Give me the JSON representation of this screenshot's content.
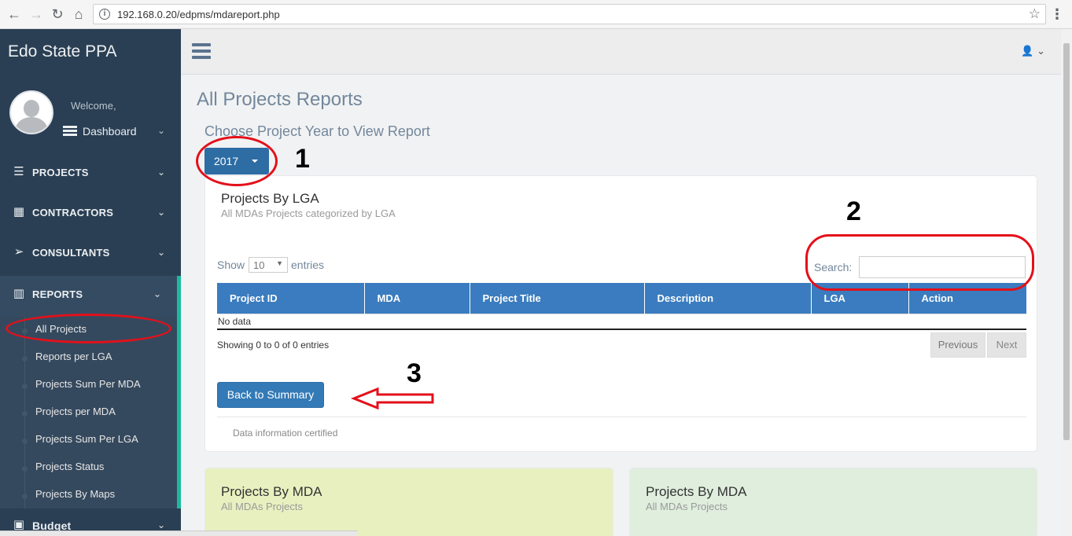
{
  "browser": {
    "url": "192.168.0.20/edpms/mdareport.php"
  },
  "sidebar": {
    "brand": "Edo State PPA",
    "welcome": "Welcome,",
    "dashboard": "Dashboard",
    "menu": [
      {
        "label": "PROJECTS",
        "icon": "projects-icon"
      },
      {
        "label": "CONTRACTORS",
        "icon": "building-icon"
      },
      {
        "label": "CONSULTANTS",
        "icon": "paper-plane-icon"
      },
      {
        "label": "REPORTS",
        "icon": "bar-chart-icon"
      },
      {
        "label": "Budget",
        "icon": "money-icon"
      }
    ],
    "reports_submenu": [
      "All Projects",
      "Reports per LGA",
      "Projects Sum Per MDA",
      "Projects per MDA",
      "Projects Sum Per LGA",
      "Projects Status",
      "Projects By Maps"
    ]
  },
  "main": {
    "page_title": "All Projects Reports",
    "year_prompt": "Choose Project Year to View Report",
    "year_value": "2017",
    "panel": {
      "title": "Projects By LGA",
      "subtitle": "All MDAs Projects categorized by LGA",
      "show_label": "Show",
      "length_value": "10",
      "entries_label": "entries",
      "search_label": "Search:",
      "columns": [
        "Project ID",
        "MDA",
        "Project Title",
        "Description",
        "LGA",
        "Action"
      ],
      "empty_text": "No data",
      "info_text": "Showing 0 to 0 of 0 entries",
      "prev_label": "Previous",
      "next_label": "Next",
      "back_label": "Back to Summary",
      "footer_text": "Data information certified"
    },
    "cards": [
      {
        "title": "Projects By MDA",
        "subtitle": "All MDAs Projects"
      },
      {
        "title": "Projects By MDA",
        "subtitle": "All MDAs Projects"
      }
    ]
  },
  "annotations": {
    "marker_1": "1",
    "marker_2": "2",
    "marker_3": "3",
    "color": "#e3101a"
  },
  "colors": {
    "sidebar": "#2a3f54",
    "accent": "#1abb9c",
    "table_header": "#3a7cbf",
    "button": "#337ab7"
  }
}
